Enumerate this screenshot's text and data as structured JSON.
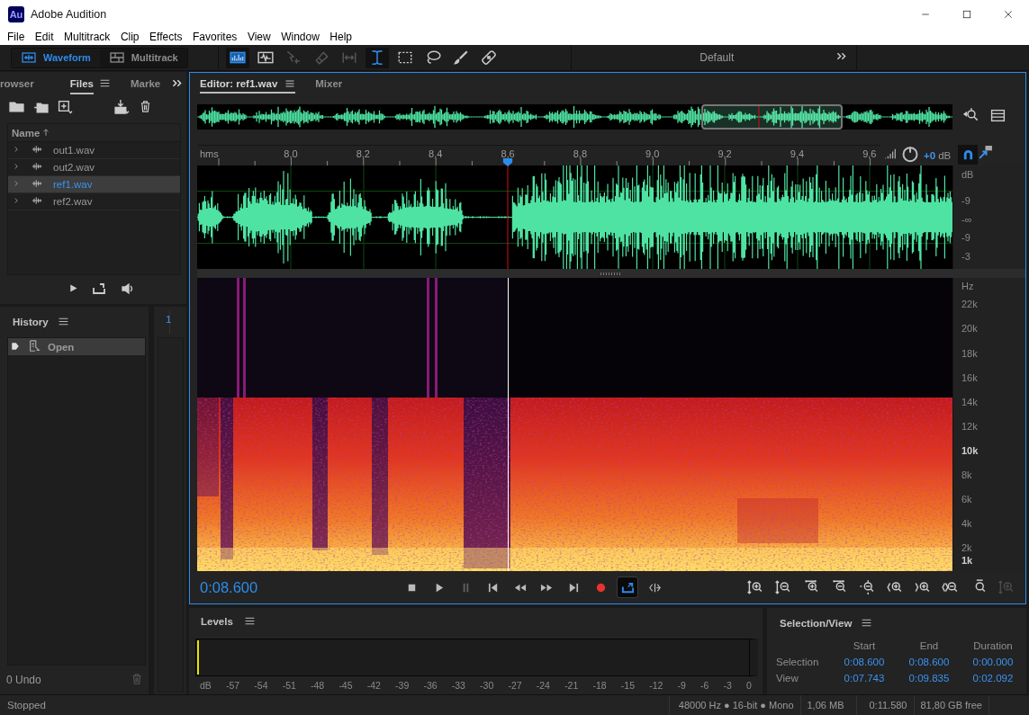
{
  "window": {
    "title": "Adobe Audition",
    "badge": "Au"
  },
  "menu": [
    "File",
    "Edit",
    "Multitrack",
    "Clip",
    "Effects",
    "Favorites",
    "View",
    "Window",
    "Help"
  ],
  "modes": [
    {
      "label": "Waveform",
      "selected": true
    },
    {
      "label": "Multitrack",
      "selected": false
    }
  ],
  "tools": [
    {
      "kind": "spectral",
      "selected": true,
      "disabled": false
    },
    {
      "kind": "waveform",
      "selected": false,
      "disabled": false
    },
    {
      "kind": "move",
      "selected": false,
      "disabled": true
    },
    {
      "kind": "razor",
      "selected": false,
      "disabled": true
    },
    {
      "kind": "slip",
      "selected": false,
      "disabled": true
    },
    {
      "kind": "time-selection",
      "selected": true,
      "disabled": false
    },
    {
      "kind": "marquee",
      "selected": false,
      "disabled": false
    },
    {
      "kind": "lasso",
      "selected": false,
      "disabled": false
    },
    {
      "kind": "brush",
      "selected": false,
      "disabled": false
    },
    {
      "kind": "healing",
      "selected": false,
      "disabled": false
    }
  ],
  "workspace": "Default",
  "files_panel": {
    "tabs": [
      {
        "label": "rowser",
        "selected": false
      },
      {
        "label": "Files",
        "selected": true
      },
      {
        "label": "Marke",
        "selected": false
      }
    ],
    "column": "Name",
    "files": [
      {
        "name": "out1.wav",
        "selected": false
      },
      {
        "name": "out2.wav",
        "selected": false
      },
      {
        "name": "ref1.wav",
        "selected": true
      },
      {
        "name": "ref2.wav",
        "selected": false
      }
    ]
  },
  "history_panel": {
    "title": "History",
    "items": [
      {
        "label": "Open",
        "selected": true
      }
    ],
    "undo": "0 Undo"
  },
  "side_panel_tab": "1",
  "editor": {
    "tabs": [
      {
        "label": "Editor: ref1.wav",
        "selected": true
      },
      {
        "label": "Mixer",
        "selected": false
      }
    ],
    "ruler": {
      "unit": "hms",
      "ticks": [
        "8,0",
        "8,2",
        "8,4",
        "8,6",
        "8,8",
        "9,0",
        "9,2",
        "9,4",
        "9,6"
      ]
    },
    "gain": {
      "value": "+0",
      "unit": "dB"
    },
    "db_scale": [
      "dB",
      "-9",
      "-∞",
      "-9",
      "-3"
    ],
    "hz_scale": [
      {
        "label": "Hz",
        "major": false
      },
      {
        "label": "22k",
        "major": false
      },
      {
        "label": "20k",
        "major": false
      },
      {
        "label": "18k",
        "major": false
      },
      {
        "label": "16k",
        "major": false
      },
      {
        "label": "14k",
        "major": false
      },
      {
        "label": "12k",
        "major": false
      },
      {
        "label": "10k",
        "major": true
      },
      {
        "label": "8k",
        "major": false
      },
      {
        "label": "6k",
        "major": false
      },
      {
        "label": "4k",
        "major": false
      },
      {
        "label": "2k",
        "major": false
      },
      {
        "label": "1k",
        "major": true
      }
    ],
    "time": "0:08.600",
    "transport": [
      {
        "kind": "stop",
        "on": false,
        "disabled": false
      },
      {
        "kind": "play",
        "on": false,
        "disabled": false
      },
      {
        "kind": "pause",
        "on": false,
        "disabled": true
      },
      {
        "kind": "to-start",
        "on": false,
        "disabled": false
      },
      {
        "kind": "rewind",
        "on": false,
        "disabled": false
      },
      {
        "kind": "forward",
        "on": false,
        "disabled": false
      },
      {
        "kind": "to-end",
        "on": false,
        "disabled": false
      },
      {
        "kind": "record",
        "on": false,
        "disabled": false
      },
      {
        "kind": "loop",
        "on": true,
        "disabled": false
      },
      {
        "kind": "skip",
        "on": false,
        "disabled": false
      }
    ],
    "zoom": [
      {
        "kind": "in-amplitude",
        "disabled": false
      },
      {
        "kind": "out-amplitude",
        "disabled": false
      },
      {
        "kind": "in-time",
        "disabled": false
      },
      {
        "kind": "out-time",
        "disabled": false
      },
      {
        "kind": "out-full",
        "disabled": false
      },
      {
        "kind": "in-start",
        "disabled": false
      },
      {
        "kind": "in-end",
        "disabled": false
      },
      {
        "kind": "selection",
        "disabled": false
      },
      {
        "kind": "reset",
        "disabled": false
      },
      {
        "kind": "in-spectral",
        "disabled": true
      }
    ]
  },
  "levels": {
    "title": "Levels",
    "scale": [
      "dB",
      "-57",
      "-54",
      "-51",
      "-48",
      "-45",
      "-42",
      "-39",
      "-36",
      "-33",
      "-30",
      "-27",
      "-24",
      "-21",
      "-18",
      "-15",
      "-12",
      "-9",
      "-6",
      "-3",
      "0"
    ]
  },
  "selection_view": {
    "title": "Selection/View",
    "columns": [
      "Start",
      "End",
      "Duration"
    ],
    "rows": [
      {
        "label": "Selection",
        "values": [
          "0:08.600",
          "0:08.600",
          "0:00.000"
        ]
      },
      {
        "label": "View",
        "values": [
          "0:07.743",
          "0:09.835",
          "0:02.092"
        ]
      }
    ]
  },
  "status_bar": {
    "state": "Stopped",
    "cells": [
      "48000 Hz ● 16-bit ● Mono",
      "1,06 MB",
      "0:11.580",
      "81,80 GB free"
    ]
  }
}
